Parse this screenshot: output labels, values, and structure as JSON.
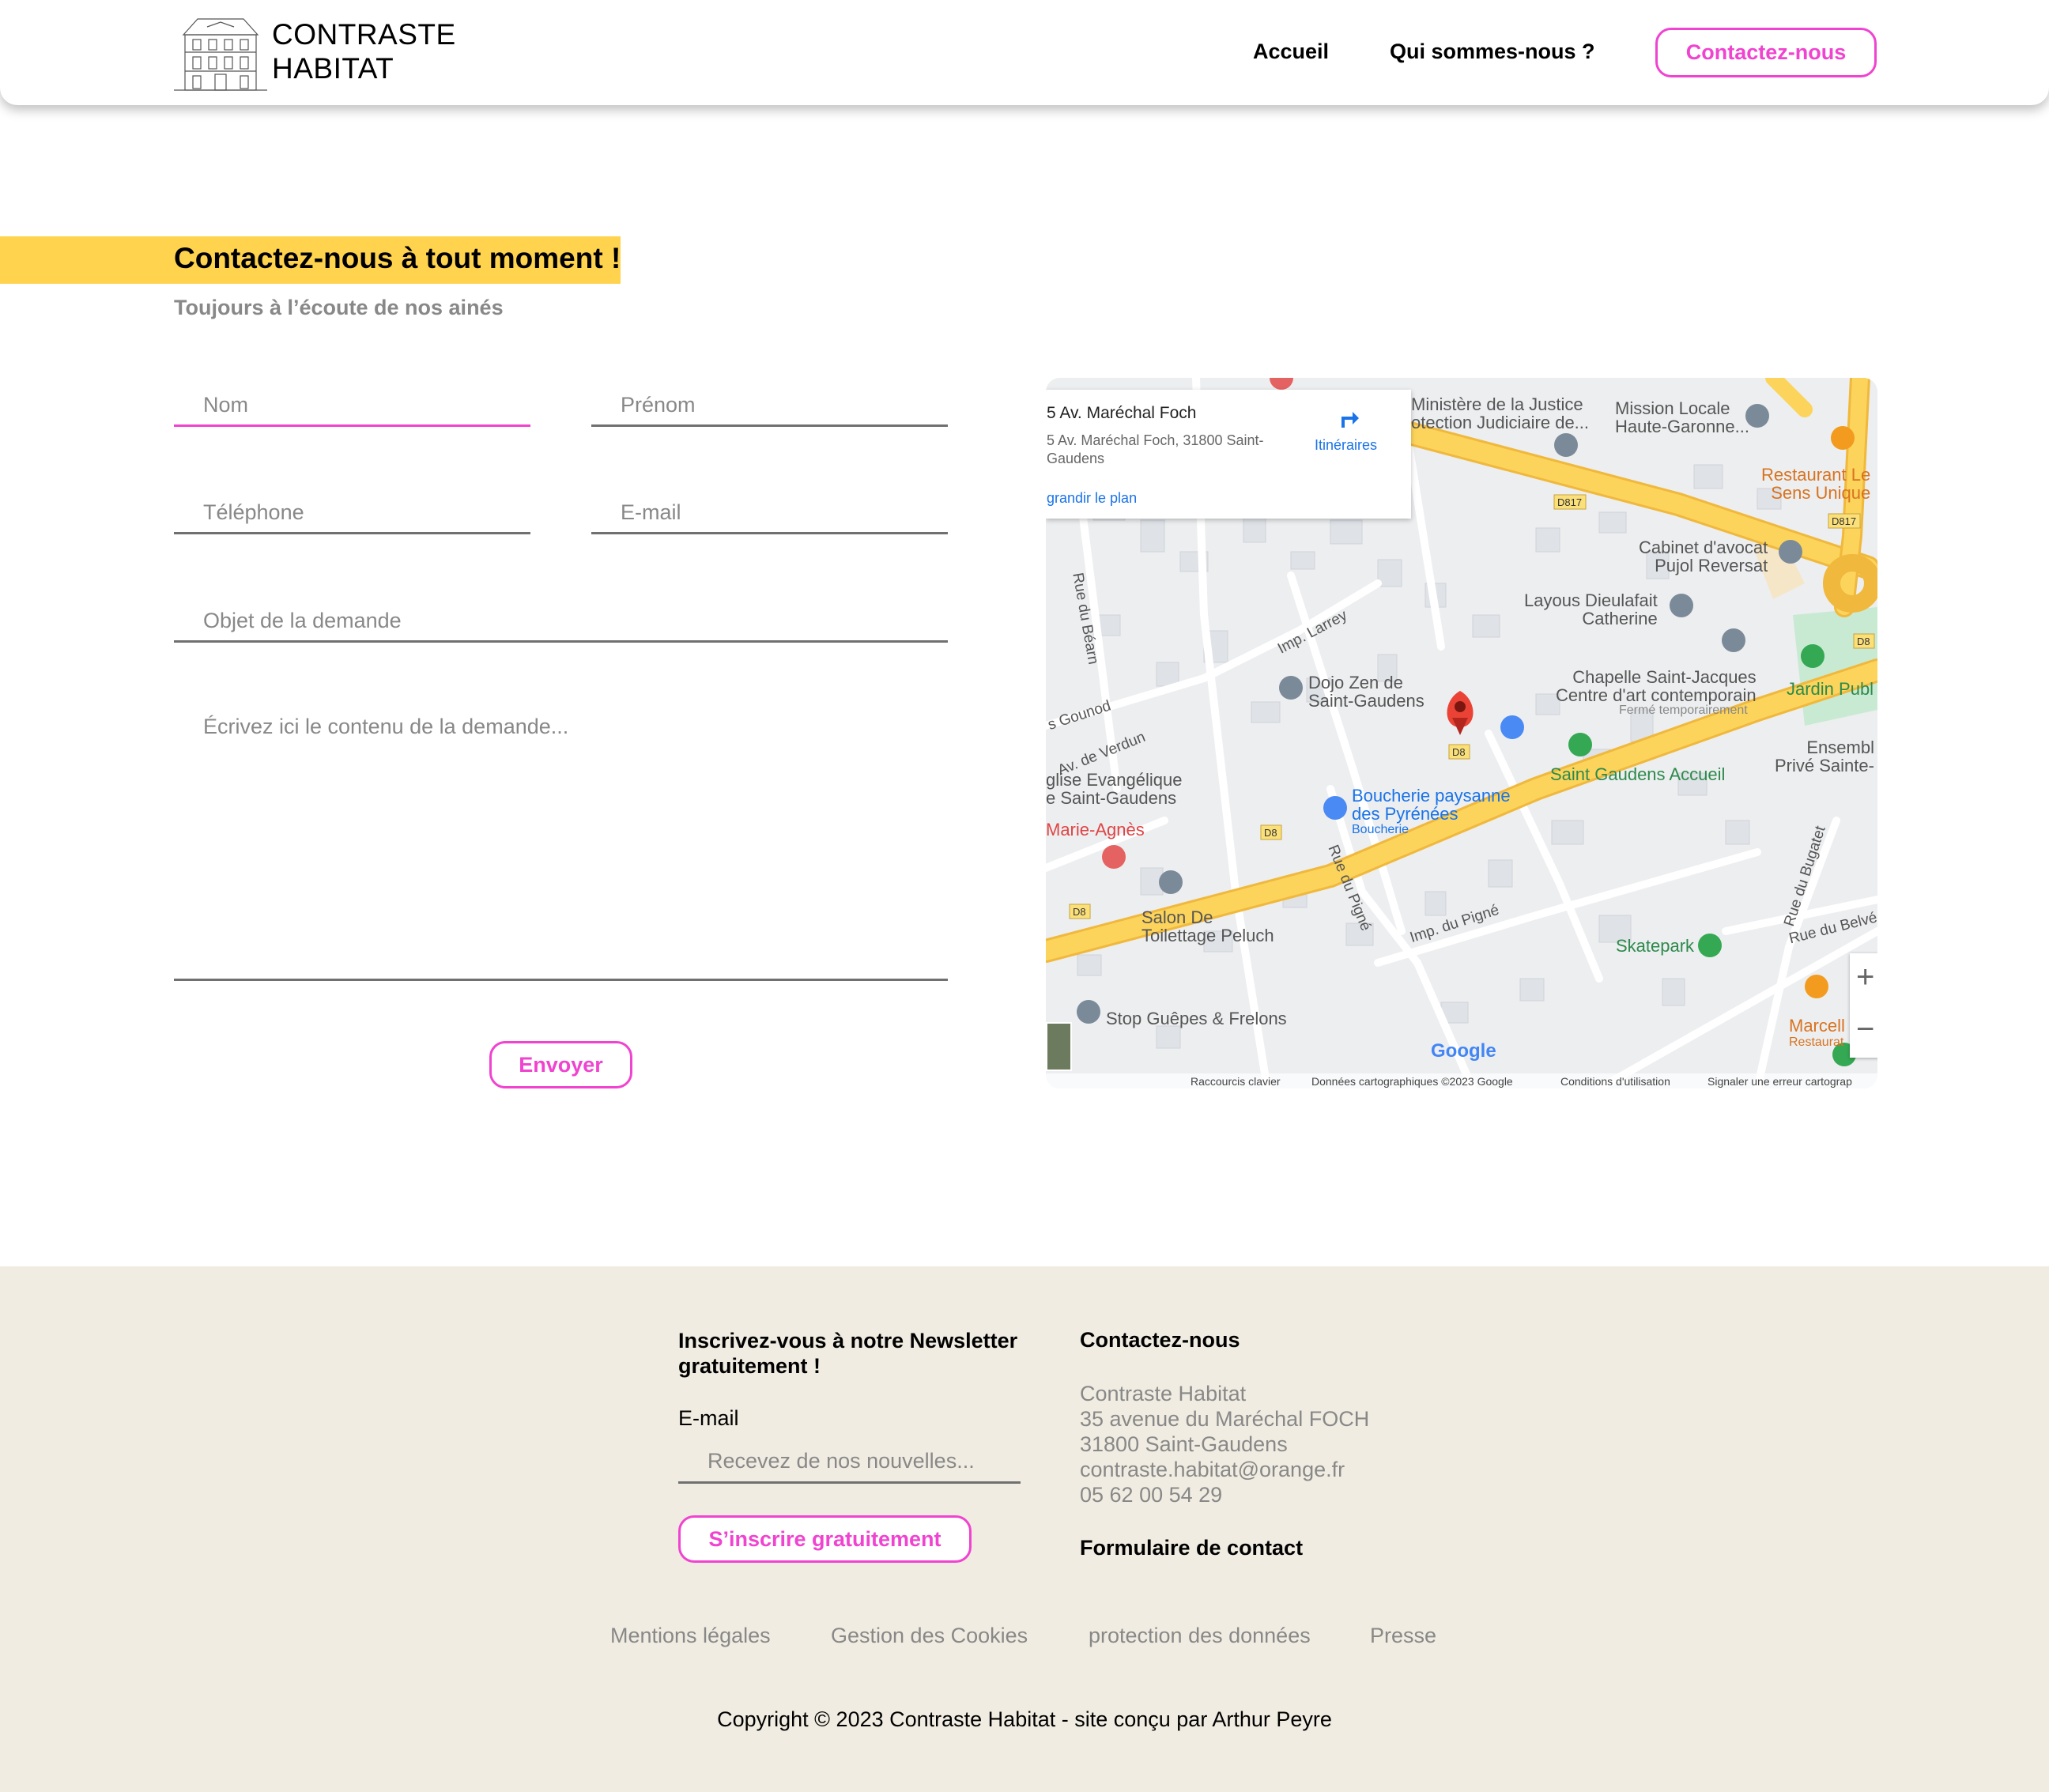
{
  "header": {
    "brand_line1": "CONTRASTE",
    "brand_line2": "HABITAT",
    "nav": {
      "accueil": "Accueil",
      "qui": "Qui sommes-nous ?",
      "contact": "Contactez-nous"
    }
  },
  "hero": {
    "title": "Contactez-nous à tout moment !",
    "subtitle": "Toujours à l’écoute de nos ainés"
  },
  "form": {
    "nom_placeholder": "Nom",
    "prenom_placeholder": "Prénom",
    "telephone_placeholder": "Téléphone",
    "email_placeholder": "E-mail",
    "objet_placeholder": "Objet de la demande",
    "message_placeholder": "Écrivez ici le contenu de la demande...",
    "submit_label": "Envoyer"
  },
  "map": {
    "card_title": "5 Av. Maréchal Foch",
    "card_address": "5 Av. Maréchal Foch, 31800 Saint-Gaudens",
    "card_link": "grandir le plan",
    "directions_label": "Itinéraires",
    "places": {
      "ministere": "Ministère de la Justice\notection Judiciaire de...",
      "mission": "Mission Locale\nHaute-Garonne...",
      "restaurant": "Restaurant Le\nSens Unique",
      "cabinet": "Cabinet d'avocat\nPujol Reversat",
      "layous": "Layous Dieulafait\nCatherine",
      "chapelle": "Chapelle Saint-Jacques\nCentre d'art contemporain",
      "chapelle_note": "Fermé temporairement",
      "jardin": "Jardin Publ",
      "ensemble": "Ensembl\nPrivé Sainte-",
      "dojo": "Dojo Zen de\nSaint-Gaudens",
      "saint_gaudens_accueil": "Saint Gaudens Accueil",
      "boucherie": "Boucherie paysanne\ndes Pyrénées",
      "boucherie_note": "Boucherie",
      "eglise": "glise Evangélique\ne Saint-Gaudens",
      "marie": "Marie-Agnès",
      "salon": "Salon De\nToilettage Peluch",
      "skatepark": "Skatepark",
      "marcell": "Marcell",
      "marcell_note": "Restaurat",
      "stop": "Stop Guêpes & Frelons"
    },
    "streets": {
      "bearn": "Rue du Béarn",
      "larrey": "Imp. Larrey",
      "gounod": "s Gounod",
      "verdun": "Av. de Verdun",
      "pigne": "Rue du Pigné",
      "imp_pigne": "Imp. du Pigné",
      "bugatet": "Rue du Bugatet",
      "belve": "Rue du Belvé"
    },
    "road_badges": [
      "D817",
      "D817",
      "D8",
      "D8",
      "D8",
      "D8"
    ],
    "zoom_in": "+",
    "zoom_out": "−",
    "google": "Google",
    "attribution": {
      "shortcuts": "Raccourcis clavier",
      "data": "Données cartographiques ©2023 Google",
      "terms": "Conditions d'utilisation",
      "report": "Signaler une erreur cartograp"
    },
    "colors": {
      "main_road": "#fcd45c",
      "road_edge": "#f0b83c",
      "minor_road": "#ffffff",
      "background": "#eceef0",
      "building": "#dfe2e6",
      "park": "#c9ead2",
      "pin_red": "#ea4335",
      "pin_grey": "#7b8a99",
      "pin_blue": "#4a8af4",
      "pin_green": "#34a853",
      "pin_orange": "#f29b1e"
    }
  },
  "footer": {
    "newsletter_title": "Inscrivez-vous à notre Newsletter gratuitement !",
    "email_label": "E-mail",
    "email_placeholder": "Recevez de nos nouvelles...",
    "subscribe_label": "S’inscrire gratuitement",
    "contact_title": "Contactez-nous",
    "company": "Contraste Habitat",
    "street": "35 avenue du Maréchal FOCH",
    "city": "31800 Saint-Gaudens",
    "email": "contraste.habitat@orange.fr",
    "phone": "05 62 00 54 29",
    "form_link": "Formulaire de contact",
    "legal": {
      "mentions": "Mentions légales",
      "cookies": "Gestion des Cookies",
      "donnees": "protection des données",
      "presse": "Presse"
    },
    "copyright": "Copyright © 2023 Contraste Habitat - site conçu par Arthur Peyre"
  },
  "colors": {
    "accent_pink": "#f043d0",
    "title_yellow": "#ffd34d",
    "footer_bg": "#f0ece1",
    "muted_text": "#888888"
  }
}
